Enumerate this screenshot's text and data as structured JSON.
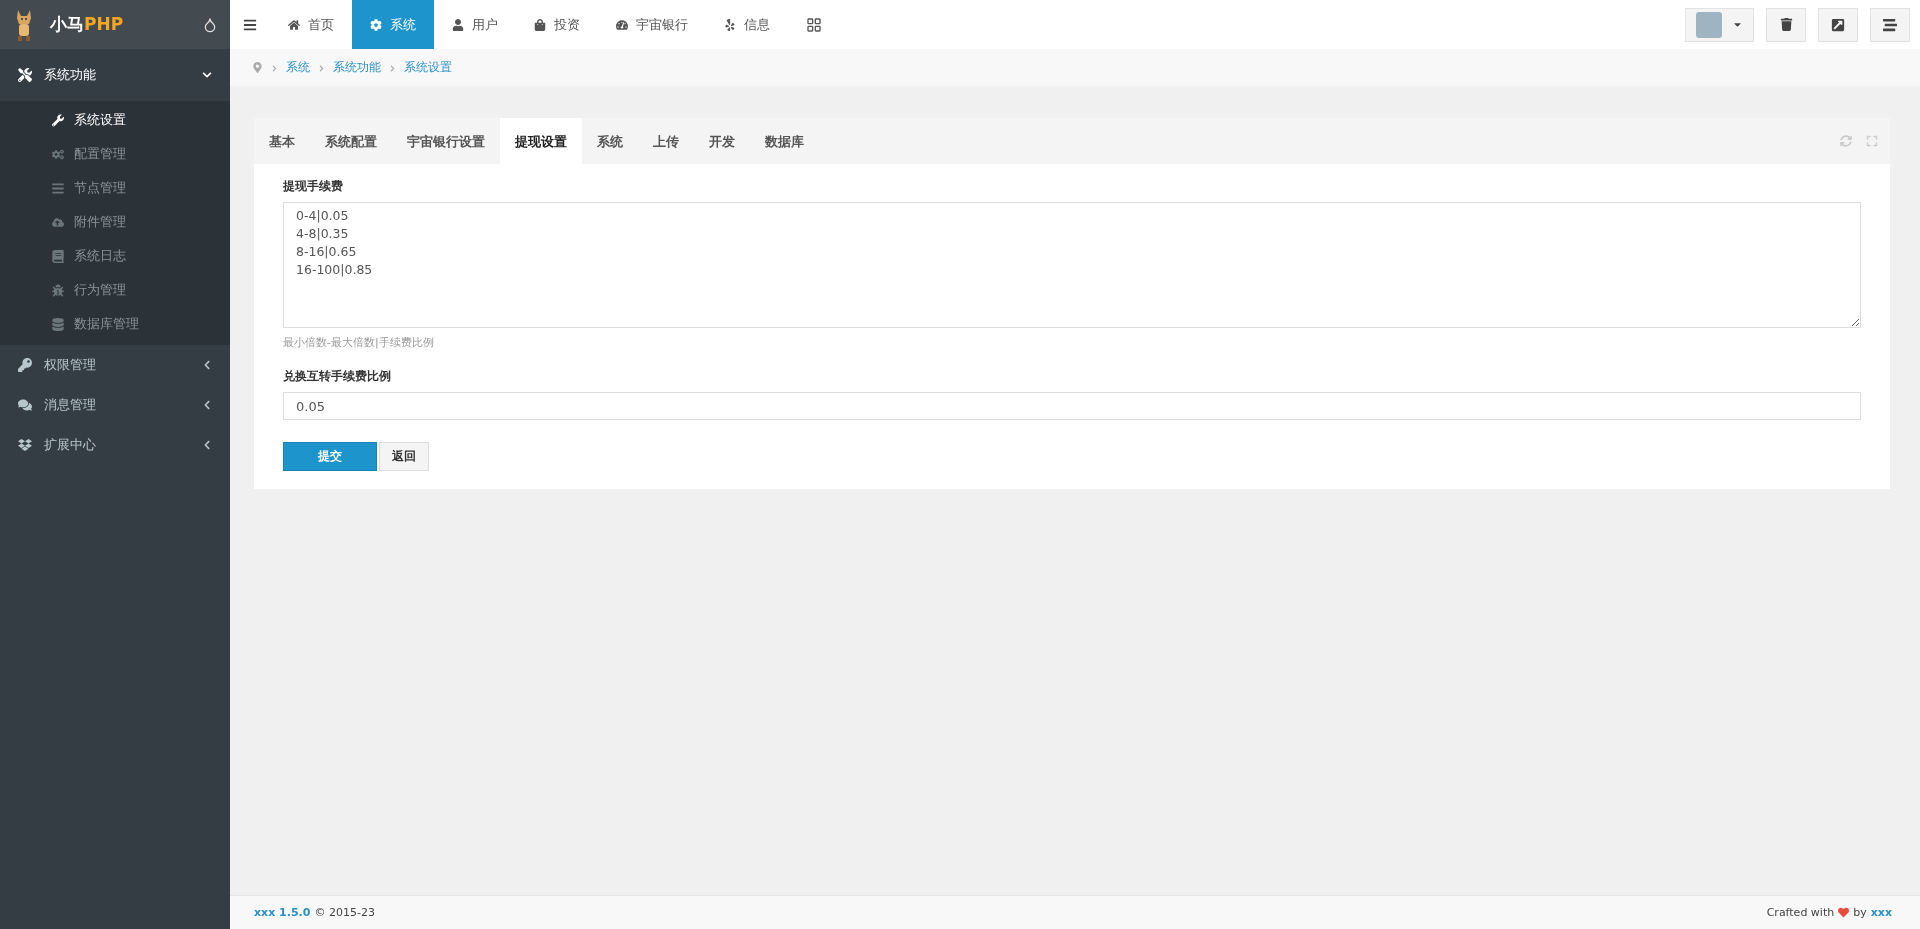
{
  "logo": {
    "prefix": "小马",
    "suffix": "PHP"
  },
  "sidebar": {
    "items": [
      {
        "label": "系统功能",
        "expanded": true,
        "children": [
          {
            "label": "系统设置",
            "selected": true
          },
          {
            "label": "配置管理",
            "selected": false
          },
          {
            "label": "节点管理",
            "selected": false
          },
          {
            "label": "附件管理",
            "selected": false
          },
          {
            "label": "系统日志",
            "selected": false
          },
          {
            "label": "行为管理",
            "selected": false
          },
          {
            "label": "数据库管理",
            "selected": false
          }
        ]
      },
      {
        "label": "权限管理",
        "expanded": false
      },
      {
        "label": "消息管理",
        "expanded": false
      },
      {
        "label": "扩展中心",
        "expanded": false
      }
    ]
  },
  "nav": [
    {
      "label": "首页",
      "selected": false
    },
    {
      "label": "系统",
      "selected": true
    },
    {
      "label": "用户",
      "selected": false
    },
    {
      "label": "投资",
      "selected": false
    },
    {
      "label": "宇宙银行",
      "selected": false
    },
    {
      "label": "信息",
      "selected": false
    }
  ],
  "breadcrumb": [
    "系统",
    "系统功能",
    "系统设置"
  ],
  "tabs": [
    {
      "label": "基本",
      "selected": false
    },
    {
      "label": "系统配置",
      "selected": false
    },
    {
      "label": "宇宙银行设置",
      "selected": false
    },
    {
      "label": "提现设置",
      "selected": true
    },
    {
      "label": "系统",
      "selected": false
    },
    {
      "label": "上传",
      "selected": false
    },
    {
      "label": "开发",
      "selected": false
    },
    {
      "label": "数据库",
      "selected": false
    }
  ],
  "fields": [
    {
      "kind": "textarea",
      "label": "提现手续费",
      "value": "0-4|0.05\n4-8|0.35\n8-16|0.65\n16-100|0.85",
      "help": "最小倍数-最大倍数|手续费比例"
    },
    {
      "kind": "input",
      "label": "兑换互转手续费比例",
      "value": "0.05"
    }
  ],
  "buttons": [
    {
      "label": "提交",
      "kind": "primary"
    },
    {
      "label": "返回",
      "kind": "default"
    }
  ],
  "footer": {
    "version": "xxx 1.5.0",
    "copyright": "© 2015-23",
    "crafted": "Crafted with",
    "by": "by",
    "author": "xxx"
  }
}
